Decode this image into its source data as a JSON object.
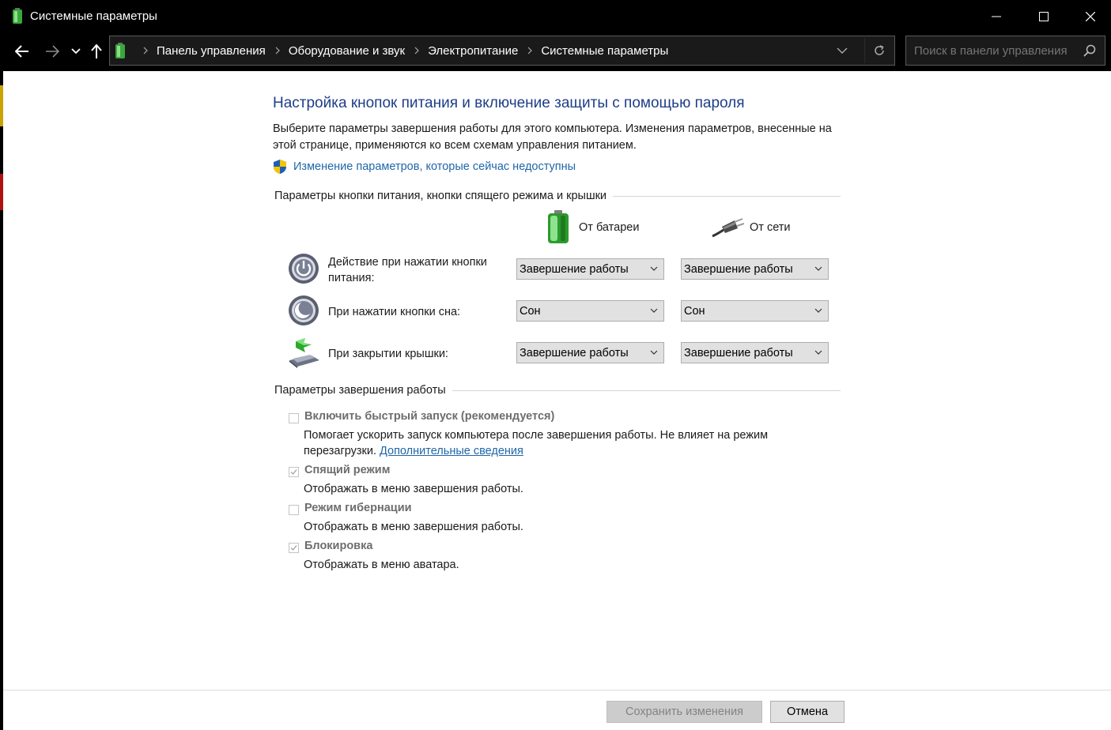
{
  "window": {
    "title": "Системные параметры"
  },
  "nav": {
    "breadcrumbs": [
      "Панель управления",
      "Оборудование и звук",
      "Электропитание",
      "Системные параметры"
    ],
    "search_placeholder": "Поиск в панели управления"
  },
  "page": {
    "heading": "Настройка кнопок питания и включение защиты с помощью пароля",
    "description": "Выберите параметры завершения работы для этого компьютера. Изменения параметров, внесенные на этой странице, применяются ко всем схемам управления питанием.",
    "change_link": "Изменение параметров, которые сейчас недоступны"
  },
  "power_group": {
    "label": "Параметры кнопки питания, кнопки спящего режима и крышки",
    "col_battery": "От батареи",
    "col_ac": "От сети",
    "rows": [
      {
        "label": "Действие при нажатии кнопки питания:",
        "battery": "Завершение работы",
        "ac": "Завершение работы",
        "icon": "power-button-icon"
      },
      {
        "label": "При нажатии кнопки сна:",
        "battery": "Сон",
        "ac": "Сон",
        "icon": "sleep-button-icon"
      },
      {
        "label": "При закрытии крышки:",
        "battery": "Завершение работы",
        "ac": "Завершение работы",
        "icon": "laptop-lid-icon"
      }
    ]
  },
  "shutdown_group": {
    "label": "Параметры завершения работы",
    "options": [
      {
        "title": "Включить быстрый запуск (рекомендуется)",
        "desc": "Помогает ускорить запуск компьютера после завершения работы. Не влияет на режим перезагрузки.",
        "link": "Дополнительные сведения",
        "checked": false
      },
      {
        "title": "Спящий режим",
        "desc": "Отображать в меню завершения работы.",
        "checked": true
      },
      {
        "title": "Режим гибернации",
        "desc": "Отображать в меню завершения работы.",
        "checked": false
      },
      {
        "title": "Блокировка",
        "desc": "Отображать в меню аватара.",
        "checked": true
      }
    ]
  },
  "footer": {
    "save_label": "Сохранить изменения",
    "cancel_label": "Отмена"
  },
  "colors": {
    "heading": "#1e3d88",
    "link": "#1f66a8",
    "titlebar": "#000000"
  }
}
